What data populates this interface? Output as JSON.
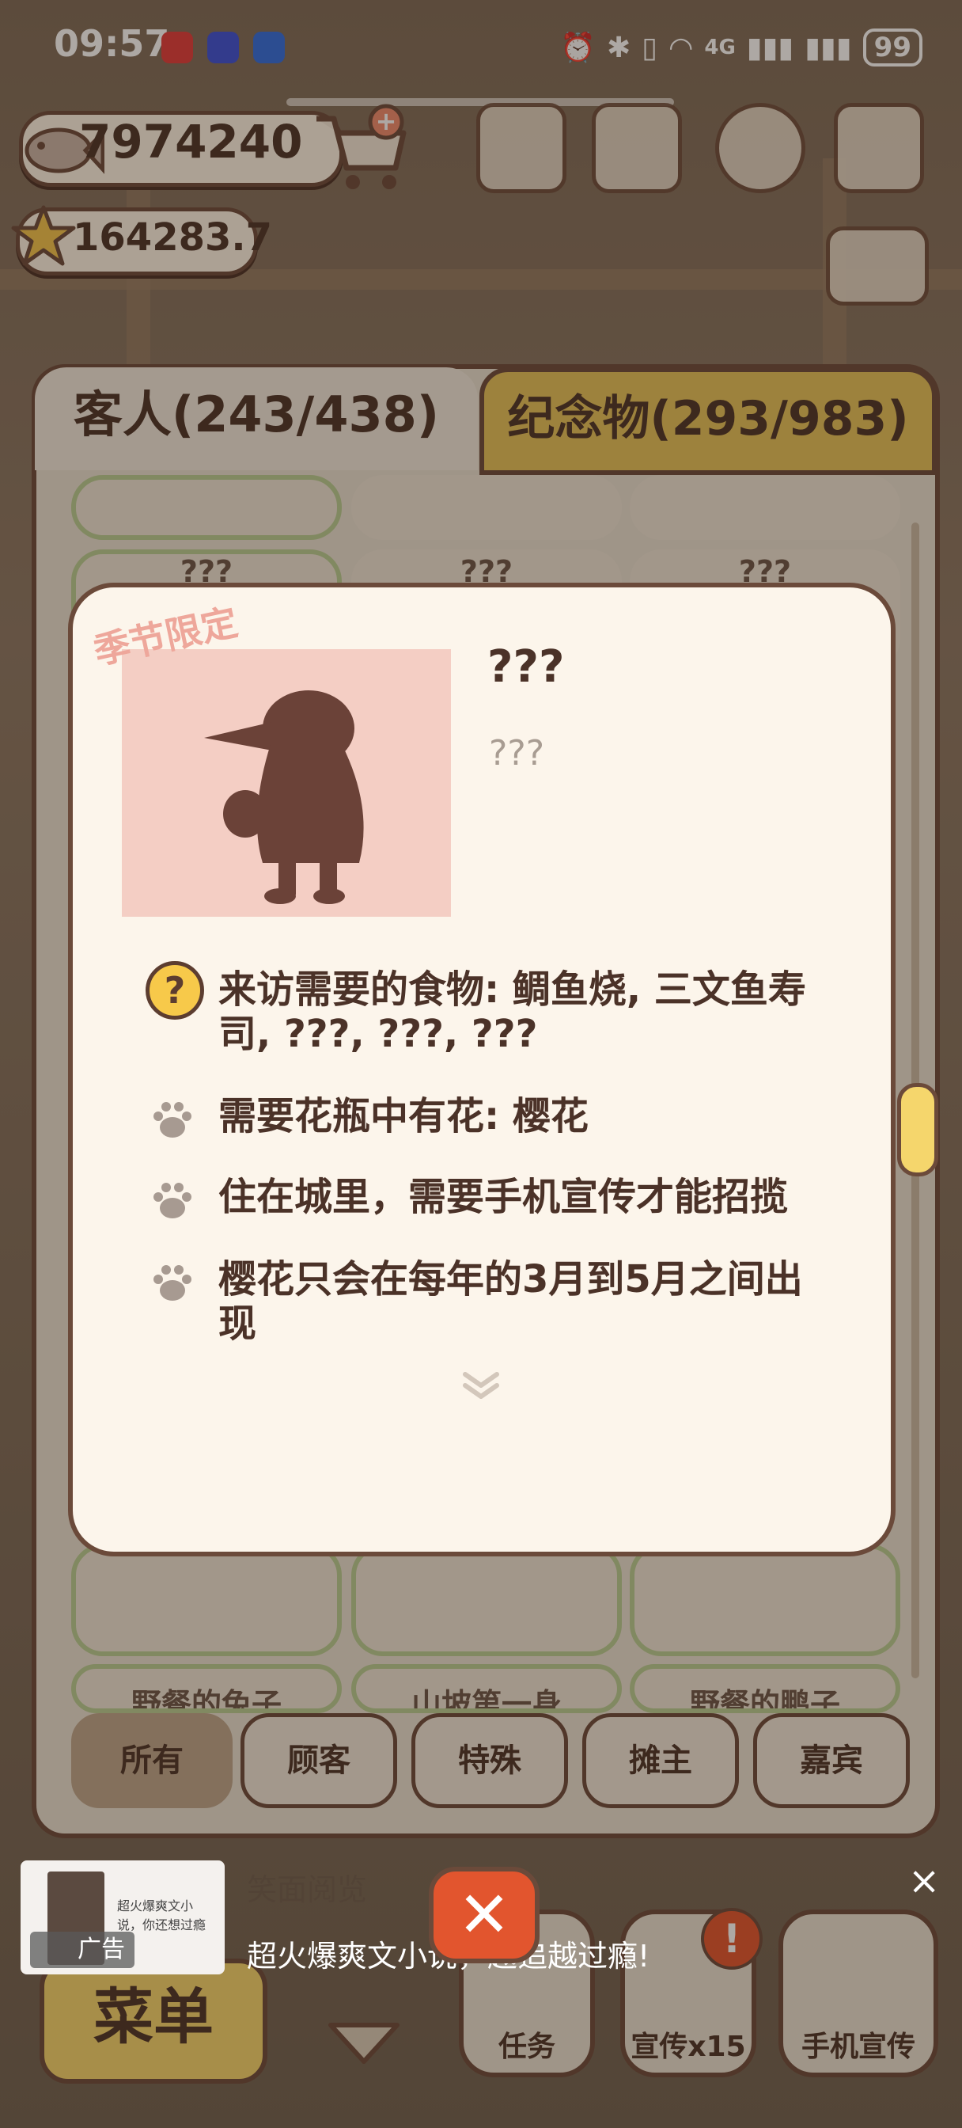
{
  "status_bar": {
    "time": "09:57",
    "battery": "99",
    "network": "4G"
  },
  "currency": {
    "fish": "7974240",
    "stars": "164283.7"
  },
  "tabs": {
    "guests": "客人(243/438)",
    "souvenirs": "纪念物(293/983)"
  },
  "cards_behind": {
    "row1_labels": [
      "???",
      "???",
      "???"
    ],
    "row3_labels": [
      "野餐的兔子",
      "山坡第一身",
      "野餐的鹏子"
    ]
  },
  "detail": {
    "season_tag": "季节限定",
    "name": "???",
    "subtitle": "???",
    "food_line1": "来访需要的食物: 鲷鱼烧, 三文鱼寿",
    "food_line2": "司, ???, ???, ???",
    "flower": "需要花瓶中有花: 樱花",
    "city": "住在城里，需要手机宣传才能招揽",
    "season_line1": "樱花只会在每年的3月到5月之间出",
    "season_line2": "现",
    "q_mark": "?"
  },
  "filters": [
    "所有",
    "顾客",
    "特殊",
    "摊主",
    "嘉宾"
  ],
  "bottom_bar": {
    "menu": "菜单",
    "tasks": "任务",
    "promo": "宣传x15",
    "phone_promo": "手机宣传",
    "faded_label": "笑面阅览"
  },
  "ad": {
    "label": "广告",
    "text": "超火爆爽文小说，越追越过瘾!",
    "thumb_text": "超火爆爽文小说，你还想过瘾",
    "close": "×"
  },
  "colors": {
    "panel_border": "#6b4a3a",
    "accent_yellow": "#e5c25a",
    "portrait_bg": "#f4cec4",
    "silhouette": "#6b4238"
  }
}
